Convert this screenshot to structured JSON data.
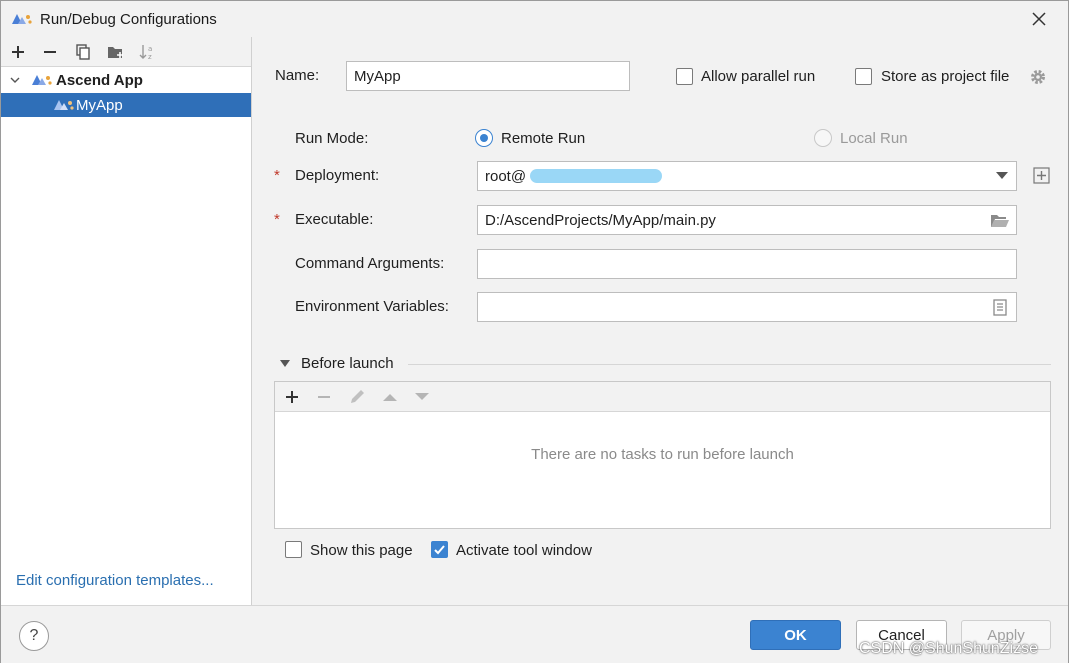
{
  "window": {
    "title": "Run/Debug Configurations"
  },
  "left": {
    "tree": [
      {
        "label": "Ascend App"
      },
      {
        "label": "MyApp"
      }
    ],
    "edit_templates": "Edit configuration templates..."
  },
  "form": {
    "name_label": "Name:",
    "name_value": "MyApp",
    "allow_parallel": "Allow parallel run",
    "store_project": "Store as project file",
    "run_mode_label": "Run Mode:",
    "remote_run": "Remote Run",
    "local_run": "Local Run",
    "deployment_label": "Deployment:",
    "deployment_value": "root@",
    "executable_label": "Executable:",
    "executable_value": "D:/AscendProjects/MyApp/main.py",
    "command_args_label": "Command Arguments:",
    "command_args_value": "",
    "env_vars_label": "Environment Variables:",
    "env_vars_value": "",
    "required_mark": "*"
  },
  "before_launch": {
    "title": "Before launch",
    "empty_text": "There are no tasks to run before launch"
  },
  "options": {
    "show_this_page": "Show this page",
    "activate_tool_window": "Activate tool window"
  },
  "buttons": {
    "ok": "OK",
    "cancel": "Cancel",
    "apply": "Apply",
    "help": "?"
  },
  "watermark": "CSDN @ShunShunZizse",
  "colors": {
    "accent": "#3b83d1",
    "selection": "#2f6fb8",
    "link": "#2a6fb0",
    "required": "#c0392b"
  }
}
